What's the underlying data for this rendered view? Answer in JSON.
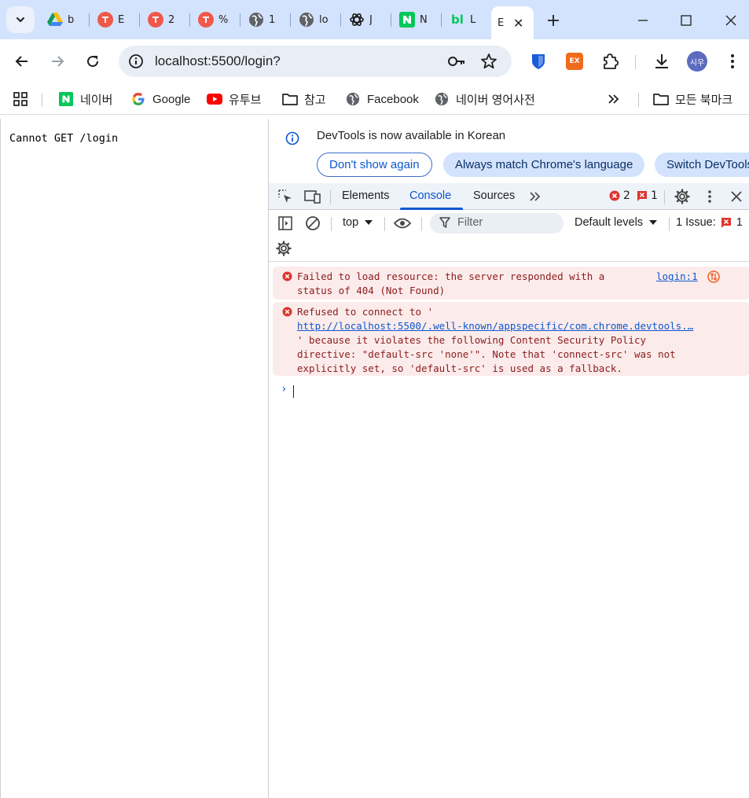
{
  "tabs": [
    {
      "title": "b",
      "icon": "google-drive-icon"
    },
    {
      "title": "E",
      "icon": "figma-red-icon"
    },
    {
      "title": "2",
      "icon": "figma-red-icon"
    },
    {
      "title": "%",
      "icon": "figma-red-icon"
    },
    {
      "title": "1",
      "icon": "globe-icon"
    },
    {
      "title": "lo",
      "icon": "globe-icon"
    },
    {
      "title": "J",
      "icon": "openai-icon"
    },
    {
      "title": "N",
      "icon": "naver-icon"
    },
    {
      "title": "L",
      "icon": "blog-icon"
    },
    {
      "title": "E",
      "icon": "active-tab",
      "active": true
    }
  ],
  "address_bar": {
    "url": "localhost:5500/login?"
  },
  "profile": {
    "initials": "시우"
  },
  "extensions": {
    "ex_label": "EX"
  },
  "bookmarks": [
    {
      "label": "네이버"
    },
    {
      "label": "Google"
    },
    {
      "label": "유투브"
    },
    {
      "label": "참고"
    },
    {
      "label": "Facebook"
    },
    {
      "label": "네이버 영어사전"
    }
  ],
  "bookmarks_all": "모든 북마크",
  "page": {
    "text": "Cannot GET /login"
  },
  "devtools": {
    "infobar": {
      "message": "DevTools is now available in Korean",
      "dont_show": "Don't show again",
      "always_match": "Always match Chrome's language",
      "switch": "Switch DevTools"
    },
    "tabs": {
      "elements": "Elements",
      "console": "Console",
      "sources": "Sources"
    },
    "error_count": "2",
    "issue_count": "1",
    "console_toolbar": {
      "context": "top",
      "filter_placeholder": "Filter",
      "levels": "Default levels",
      "issues_label": "1 Issue:",
      "issues_count": "1"
    },
    "messages": [
      {
        "line1": "Failed to load resource: the server responded with a",
        "line2": "status of 404 (Not Found)",
        "source": "login:1"
      },
      {
        "line1": "Refused to connect to '",
        "link": "http://localhost:5500/.well-known/appspecific/com.chrome.devtools.…",
        "line3": "' because it violates the following Content Security Policy",
        "line4": "directive: \"default-src 'none'\". Note that 'connect-src' was not",
        "line5": "explicitly set, so 'default-src' is used as a fallback."
      }
    ],
    "prompt": "›"
  },
  "colors": {
    "tabstrip_bg": "#d3e3fd",
    "accent": "#0b57d0",
    "error_bg": "#fcebeb",
    "error_text": "#8a1c1c",
    "error_icon": "#dc362e"
  }
}
